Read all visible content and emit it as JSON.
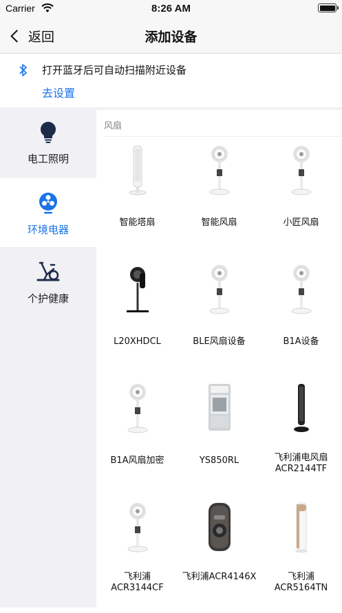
{
  "status_bar": {
    "carrier": "Carrier",
    "time": "8:26 AM"
  },
  "nav": {
    "back_label": "返回",
    "title": "添加设备"
  },
  "bluetooth_banner": {
    "message": "打开蓝牙后可自动扫描附近设备",
    "link": "去设置"
  },
  "sidebar": {
    "items": [
      {
        "label": "电工照明",
        "icon": "bulb-icon",
        "active": false
      },
      {
        "label": "环境电器",
        "icon": "fan-icon",
        "active": true
      },
      {
        "label": "个护健康",
        "icon": "exercise-bike-icon",
        "active": false
      }
    ]
  },
  "content": {
    "category": "风扇",
    "devices": [
      {
        "name": "智能塔扇",
        "type": "tower-fan"
      },
      {
        "name": "智能风扇",
        "type": "circulator-fan"
      },
      {
        "name": "小匠风扇",
        "type": "circulator-fan"
      },
      {
        "name": "L20XHDCL",
        "type": "black-fan"
      },
      {
        "name": "BLE风扇设备",
        "type": "circulator-fan"
      },
      {
        "name": "B1A设备",
        "type": "circulator-fan"
      },
      {
        "name": "B1A风扇加密",
        "type": "circulator-fan"
      },
      {
        "name": "YS850RL",
        "type": "air-cooler"
      },
      {
        "name": "飞利浦电风扇ACR2144TF",
        "type": "black-tower-fan"
      },
      {
        "name": "飞利浦ACR3144CF",
        "type": "circulator-fan"
      },
      {
        "name": "飞利浦ACR4146X",
        "type": "dark-cooler"
      },
      {
        "name": "飞利浦ACR5164TN",
        "type": "tan-tower-fan"
      }
    ]
  },
  "colors": {
    "accent": "#1a73e8",
    "sidebar_bg": "#f0f0f5",
    "nav_bg": "#f7f7f7"
  }
}
